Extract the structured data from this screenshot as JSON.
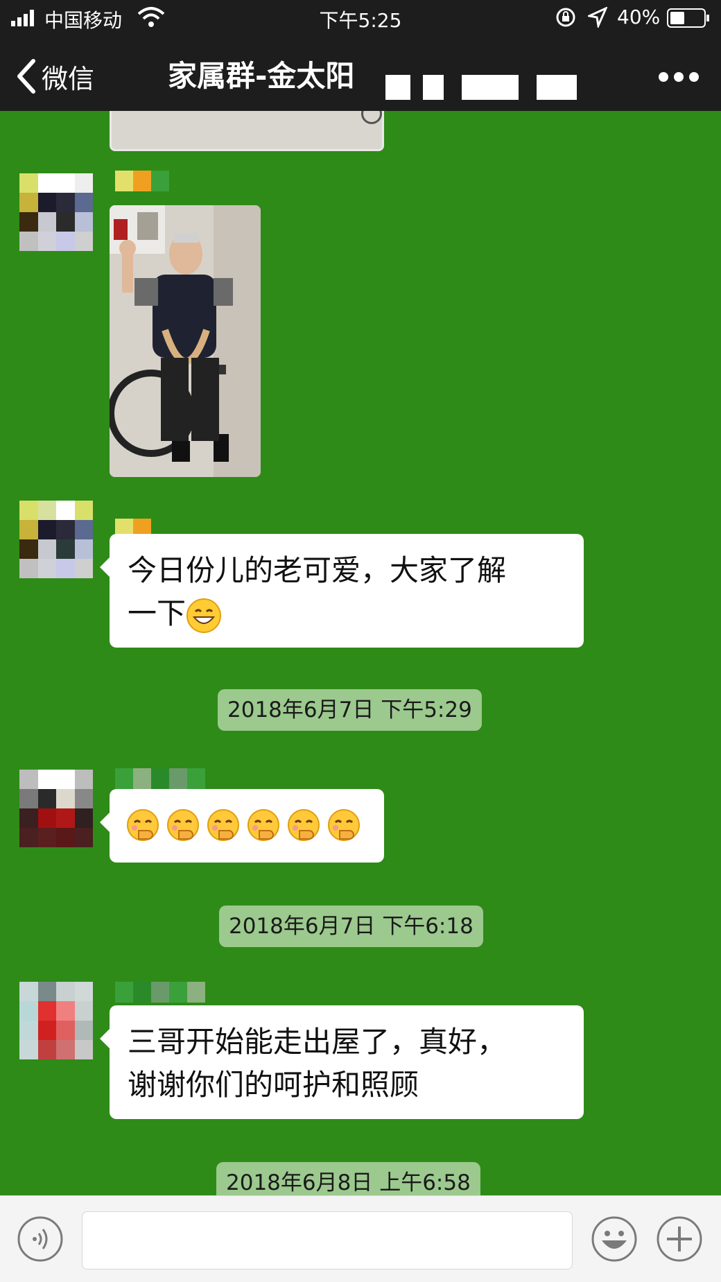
{
  "status_bar": {
    "carrier": "中国移动",
    "time": "下午5:25",
    "battery": "40%"
  },
  "header": {
    "back_label": "微信",
    "title": "家属群-金太阳",
    "more_icon": "more-dots-icon"
  },
  "messages": [
    {
      "type": "image",
      "description_icon": "photo",
      "content": ""
    },
    {
      "type": "text",
      "text_line1": "今日份儿的老可爱，大家了解",
      "text_line2": "一下",
      "emoji": "grinning-face"
    },
    {
      "type": "timestamp",
      "text": "2018年6月7日 下午5:29"
    },
    {
      "type": "emoji-row",
      "emoji": "face-with-hand-over-mouth",
      "count": 6
    },
    {
      "type": "timestamp",
      "text": "2018年6月7日 下午6:18"
    },
    {
      "type": "text",
      "text_line1": "三哥开始能走出屋了，真好，",
      "text_line2": "谢谢你们的呵护和照顾"
    },
    {
      "type": "timestamp",
      "text": "2018年6月8日 上午6:58"
    }
  ],
  "input_bar": {
    "placeholder": "",
    "value": "",
    "icons": [
      "voice-icon",
      "emoji-icon",
      "plus-icon"
    ]
  },
  "colors": {
    "chat_background": "#2e8b17",
    "header_background": "#1d1d1d",
    "bubble": "#ffffff",
    "timestamp_bg": "#9cc98e"
  }
}
